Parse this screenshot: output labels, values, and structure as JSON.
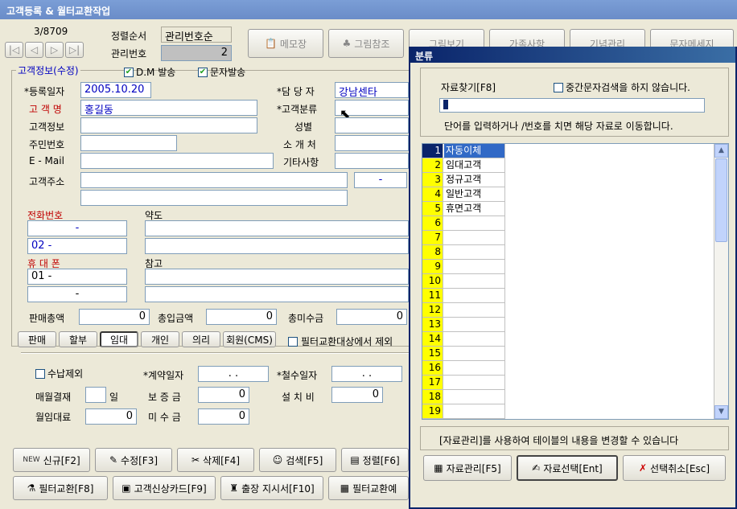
{
  "window": {
    "title": "고객등록 & 월터교환작업"
  },
  "nav": {
    "counter": "3/8709"
  },
  "sort": {
    "label": "정렬순서",
    "value": "관리번호순"
  },
  "mgmt": {
    "label": "관리번호",
    "value": "2"
  },
  "toolbar": {
    "memo": "메모장",
    "picref": "그림참조",
    "picview": "그림보기",
    "family": "가족사항",
    "anniv": "기념관리",
    "sms": "문자메세지"
  },
  "section": {
    "title": "고객정보(수정)",
    "dm": "D.M 발송",
    "sms_send": "문자발송"
  },
  "form": {
    "reg_date_label": "*등록일자",
    "reg_date": "2005.10.20",
    "manager_label": "*담 당 자",
    "manager": "강남센타",
    "name_label": "고 객 명",
    "name": "홍길동",
    "category_label": "*고객분류",
    "category": "",
    "info_label": "고객정보",
    "gender_label": "성별",
    "ssn_label": "주민번호",
    "referrer_label": "소 개 처",
    "email_label": "E - Mail",
    "etc_label": "기타사항",
    "addr_label": "고객주소",
    "zip": "-",
    "phone_label": "전화번호",
    "phone1": "-",
    "phone2": "02  -",
    "map_label": "약도",
    "mobile_label": "휴 대 폰",
    "mobile1": "01 -",
    "mobile2": "-",
    "note_label": "참고",
    "sales_label": "판매총액",
    "sales": "0",
    "paid_label": "총입금액",
    "paid": "0",
    "unpaid_label": "총미수금",
    "unpaid": "0"
  },
  "types": [
    "판매",
    "할부",
    "임대",
    "개인",
    "의리",
    "회원(CMS)"
  ],
  "filter_exclude": "필터교환대상에서 제외",
  "lower": {
    "exclude_pay": "수납제외",
    "contract_label": "*계약일자",
    "contract": ".  .",
    "withdraw_label": "*철수일자",
    "withdraw": ".  .",
    "monthly_label": "매월결재",
    "day": "일",
    "deposit_label": "보 증 금",
    "deposit": "0",
    "install_label": "설 치 비",
    "install": "0",
    "rent_label": "월임대료",
    "rent": "0",
    "unpaid2_label": "미 수 금",
    "unpaid2": "0"
  },
  "bottom": {
    "new": "신규[F2]",
    "edit": "수정[F3]",
    "delete": "삭제[F4]",
    "search": "검색[F5]",
    "sort": "정렬[F6]",
    "filter": "필터교환[F8]",
    "card": "고객신상카드[F9]",
    "dispatch": "출장 지시서[F10]",
    "filter_plan": "필터교환예"
  },
  "dialog": {
    "title": "분류",
    "find_label": "자료찾기[F8]",
    "mid_search": "중간문자검색을 하지 않습니다.",
    "hint": "단어를 입력하거나  /번호를 치면 해당 자료로 이동합니다.",
    "rows": [
      {
        "n": "1",
        "t": "자동이체"
      },
      {
        "n": "2",
        "t": "임대고객"
      },
      {
        "n": "3",
        "t": "정규고객"
      },
      {
        "n": "4",
        "t": "일반고객"
      },
      {
        "n": "5",
        "t": "휴면고객"
      },
      {
        "n": "6",
        "t": ""
      },
      {
        "n": "7",
        "t": ""
      },
      {
        "n": "8",
        "t": ""
      },
      {
        "n": "9",
        "t": ""
      },
      {
        "n": "10",
        "t": ""
      },
      {
        "n": "11",
        "t": ""
      },
      {
        "n": "12",
        "t": ""
      },
      {
        "n": "13",
        "t": ""
      },
      {
        "n": "14",
        "t": ""
      },
      {
        "n": "15",
        "t": ""
      },
      {
        "n": "16",
        "t": ""
      },
      {
        "n": "17",
        "t": ""
      },
      {
        "n": "18",
        "t": ""
      },
      {
        "n": "19",
        "t": ""
      }
    ],
    "footer_hint": "[자료관리]를 사용하여 테이블의 내용을 변경할 수 있습니다",
    "manage": "자료관리[F5]",
    "select": "자료선택[Ent]",
    "cancel": "선택취소[Esc]"
  }
}
